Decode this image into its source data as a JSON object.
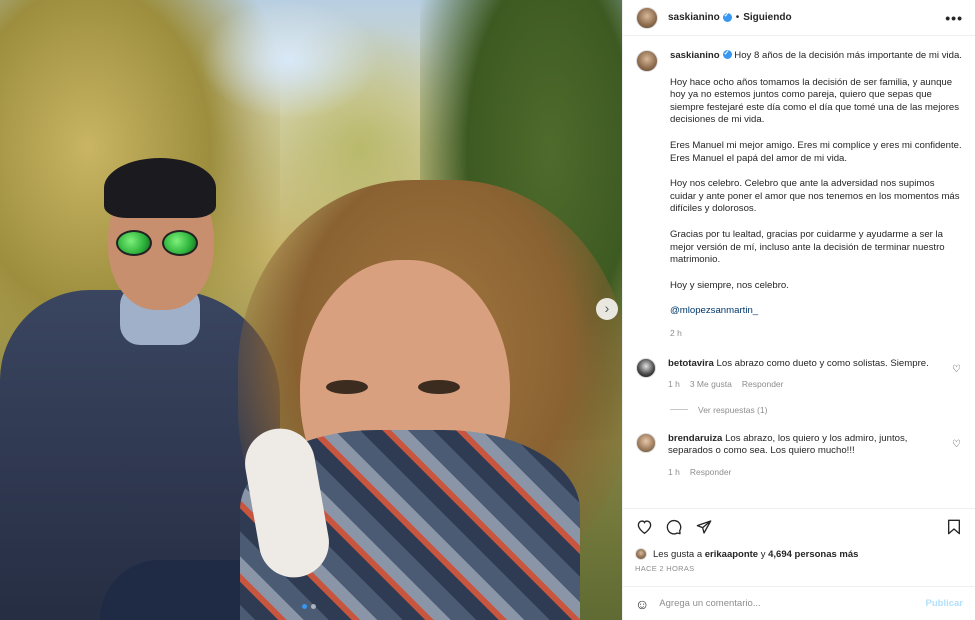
{
  "header": {
    "username": "saskianino",
    "separator": "•",
    "follow_status": "Siguiendo",
    "more_icon": "more-horizontal-icon"
  },
  "caption": {
    "username": "saskianino",
    "first_line": "Hoy 8 años de la decisión más importante de mi vida.",
    "paragraphs": [
      "Hoy hace ocho años tomamos la decisión de ser familia, y aunque hoy ya no estemos juntos como pareja, quiero que sepas que siempre festejaré este día como el día que tomé una de las mejores decisiones de mi vida.",
      "Eres Manuel mi mejor amigo. Eres mi complice y eres mi confidente. Eres Manuel el papá del amor de mi vida.",
      "Hoy nos celebro. Celebro que ante la adversidad nos supimos cuidar y ante poner el amor que nos tenemos en los momentos más difíciles y dolorosos.",
      "Gracias por tu lealtad, gracias por cuidarme y ayudarme a ser la mejor versión de mí, incluso ante la decisión de terminar nuestro matrimonio.",
      "Hoy y siempre, nos celebro."
    ],
    "mention": "@mlopezsanmartin_",
    "time": "2 h"
  },
  "comments": [
    {
      "username": "betotavira",
      "text": "Los abrazo como dueto y como solistas. Siempre.",
      "time": "1 h",
      "likes": "3 Me gusta",
      "reply": "Responder",
      "view_replies": "Ver respuestas (1)"
    },
    {
      "username": "brendaruiza",
      "text": "Los abrazo, los quiero y los admiro, juntos, separados o como sea. Los quiero mucho!!!",
      "time": "1 h",
      "reply": "Responder"
    }
  ],
  "likes": {
    "prefix": "Les gusta a",
    "user": "erikaaponte",
    "connector": "y",
    "others": "4,694 personas más"
  },
  "posted_ago": "HACE 2 HORAS",
  "add_comment": {
    "placeholder": "Agrega un comentario...",
    "publish": "Publicar"
  },
  "icons": {
    "like": "heart-icon",
    "comment": "comment-icon",
    "share": "send-icon",
    "save": "bookmark-icon",
    "emoji": "emoji-icon"
  },
  "carousel": {
    "slides": 2,
    "active": 1
  },
  "colors": {
    "link": "#00376b",
    "verified": "#3897f0",
    "publish_disabled": "#b2dffc",
    "muted": "#8e8e8e"
  }
}
